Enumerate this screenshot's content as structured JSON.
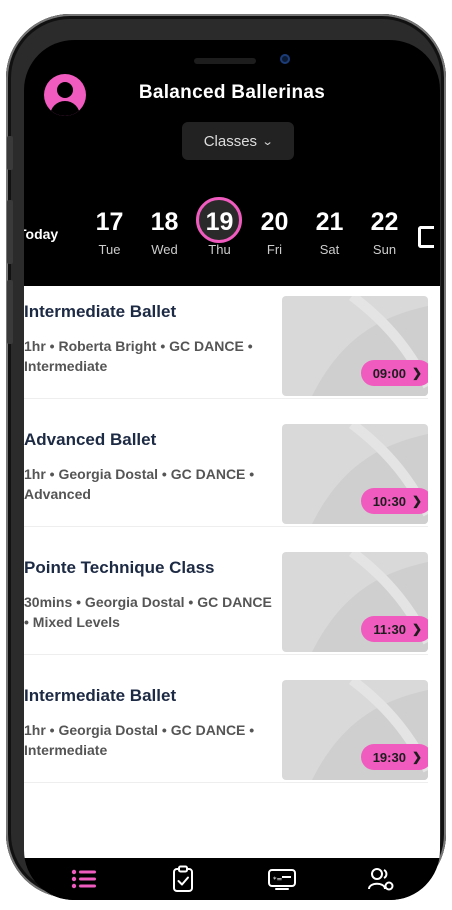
{
  "header": {
    "title": "Balanced Ballerinas",
    "dropdown_label": "Classes"
  },
  "date_strip": {
    "today_label": "Today",
    "days": [
      {
        "num": "17",
        "weekday": "Tue",
        "selected": false
      },
      {
        "num": "18",
        "weekday": "Wed",
        "selected": false
      },
      {
        "num": "19",
        "weekday": "Thu",
        "selected": true
      },
      {
        "num": "20",
        "weekday": "Fri",
        "selected": false
      },
      {
        "num": "21",
        "weekday": "Sat",
        "selected": false
      },
      {
        "num": "22",
        "weekday": "Sun",
        "selected": false
      }
    ]
  },
  "classes": [
    {
      "title": "Intermediate Ballet",
      "meta": "1hr • Roberta Bright • GC DANCE • Intermediate",
      "time": "09:00"
    },
    {
      "title": "Advanced Ballet",
      "meta": "1hr • Georgia Dostal • GC DANCE • Advanced",
      "time": "10:30"
    },
    {
      "title": "Pointe Technique Class",
      "meta": "30mins • Georgia Dostal • GC DANCE • Mixed Levels",
      "time": "11:30"
    },
    {
      "title": "Intermediate Ballet",
      "meta": "1hr • Georgia Dostal • GC DANCE • Intermediate",
      "time": "19:30"
    }
  ],
  "tabs": [
    {
      "icon": "list-icon",
      "active": true
    },
    {
      "icon": "clipboard-check-icon",
      "active": false
    },
    {
      "icon": "membership-card-icon",
      "active": false
    },
    {
      "icon": "account-icon",
      "active": false
    }
  ],
  "colors": {
    "accent": "#f05bbf",
    "background": "#000000",
    "card_title": "#1d2a44"
  }
}
